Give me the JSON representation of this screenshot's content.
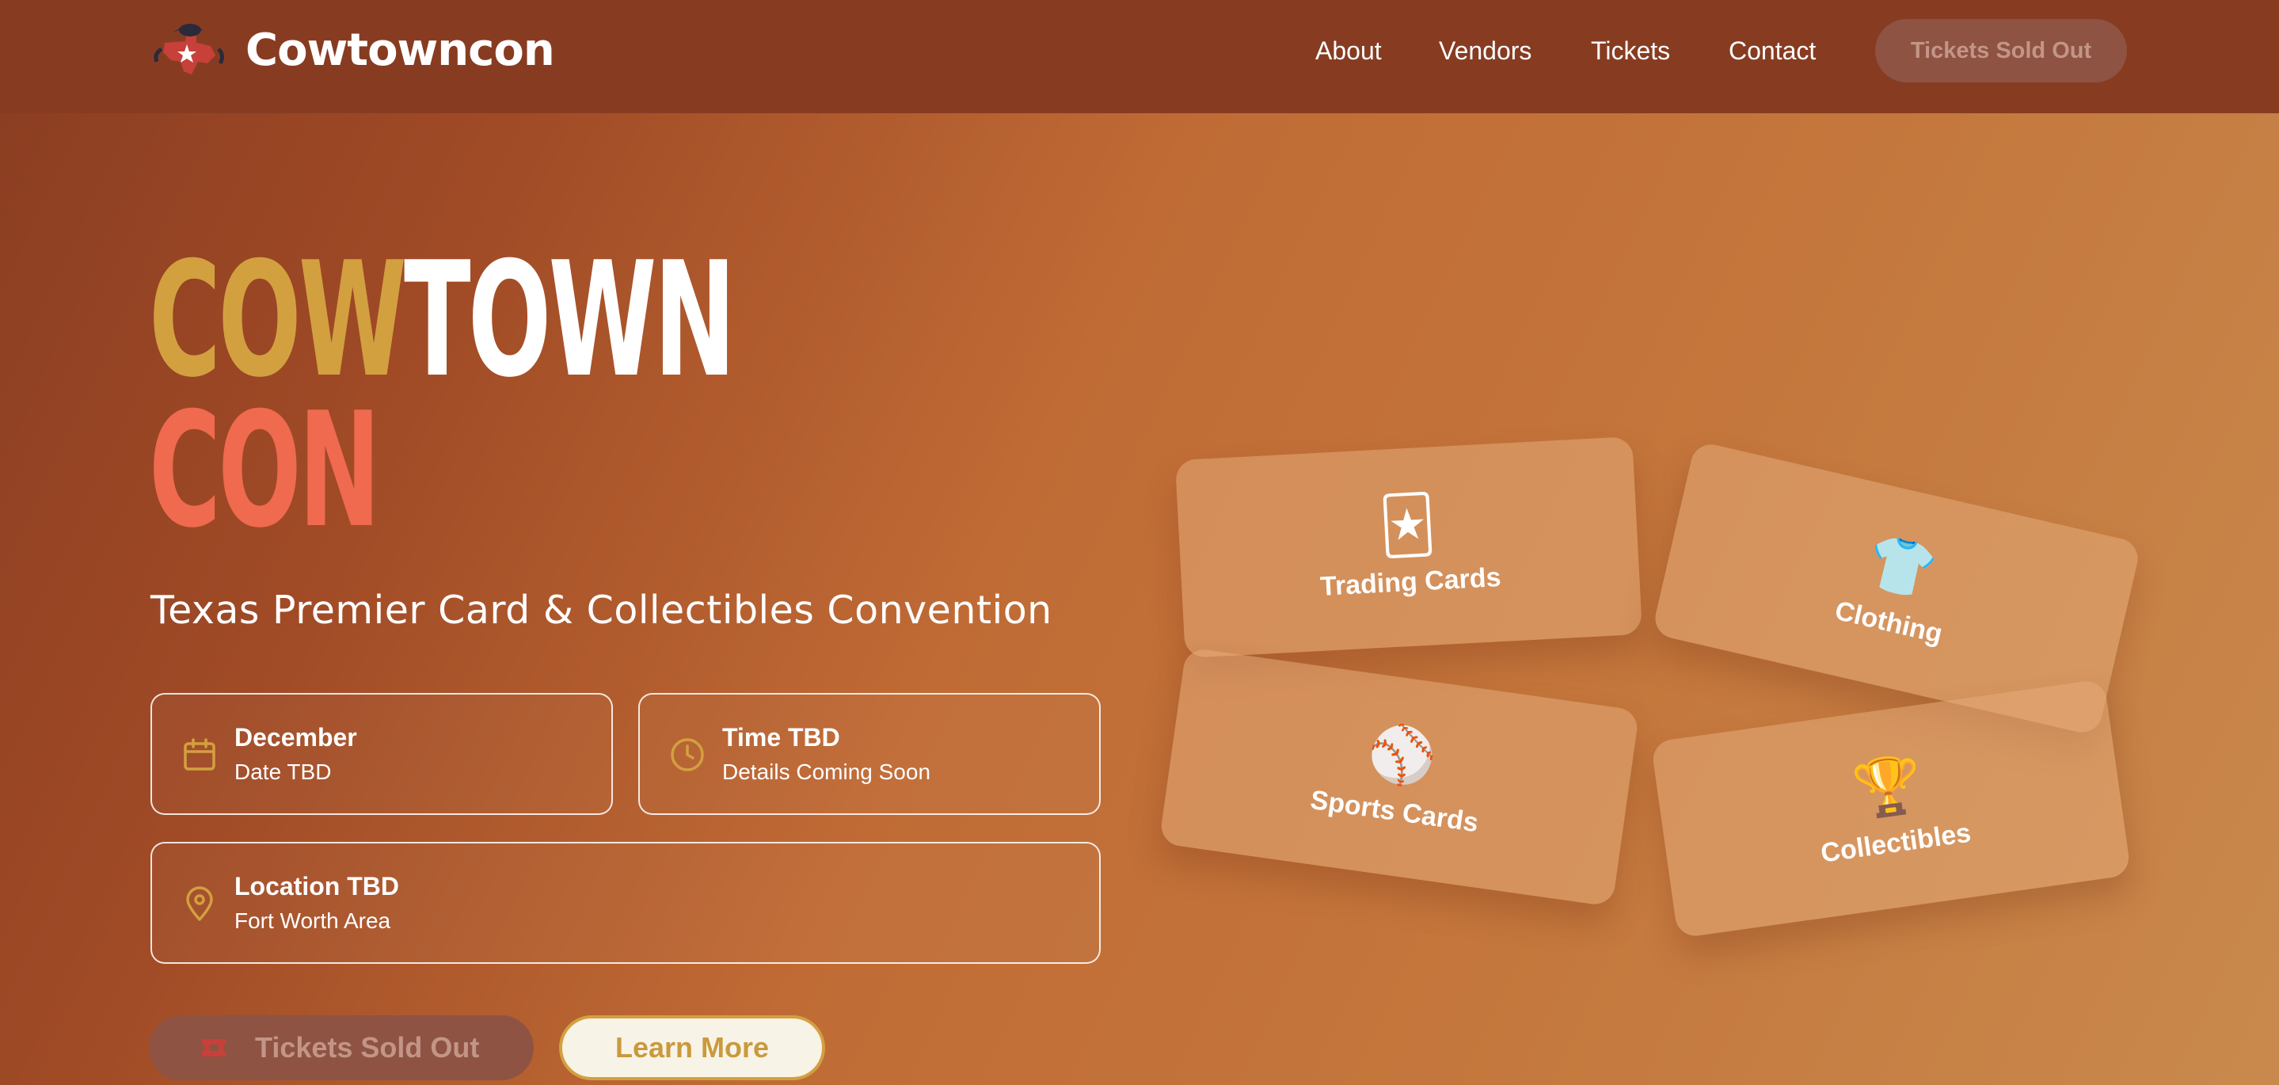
{
  "nav": {
    "brand": "Cowtowncon",
    "links": [
      "About",
      "Vendors",
      "Tickets",
      "Contact"
    ],
    "cta": "Tickets Sold Out"
  },
  "hero": {
    "title_line1_a": "COW",
    "title_line1_b": "TOWN",
    "title_line2": "CON",
    "subtitle": "Texas Premier Card & Collectibles Convention"
  },
  "info": [
    {
      "title": "December",
      "sub": "Date TBD",
      "icon": "calendar-icon"
    },
    {
      "title": "Time TBD",
      "sub": "Details Coming Soon",
      "icon": "clock-icon"
    },
    {
      "title": "Location TBD",
      "sub": "Fort Worth Area",
      "icon": "map-pin-icon"
    }
  ],
  "buttons": {
    "sold_out": "Tickets Sold Out",
    "learn_more": "Learn More"
  },
  "categories": [
    {
      "label": "Trading Cards",
      "icon": "🃏"
    },
    {
      "label": "Clothing",
      "icon": "👕"
    },
    {
      "label": "Sports Cards",
      "icon": "⚾"
    },
    {
      "label": "Collectibles",
      "icon": "🏆"
    }
  ],
  "colors": {
    "gold": "#d3a040",
    "coral": "#ef6a4e",
    "nav_bg": "#873c22",
    "sold_out_bg": "#8e5343"
  }
}
